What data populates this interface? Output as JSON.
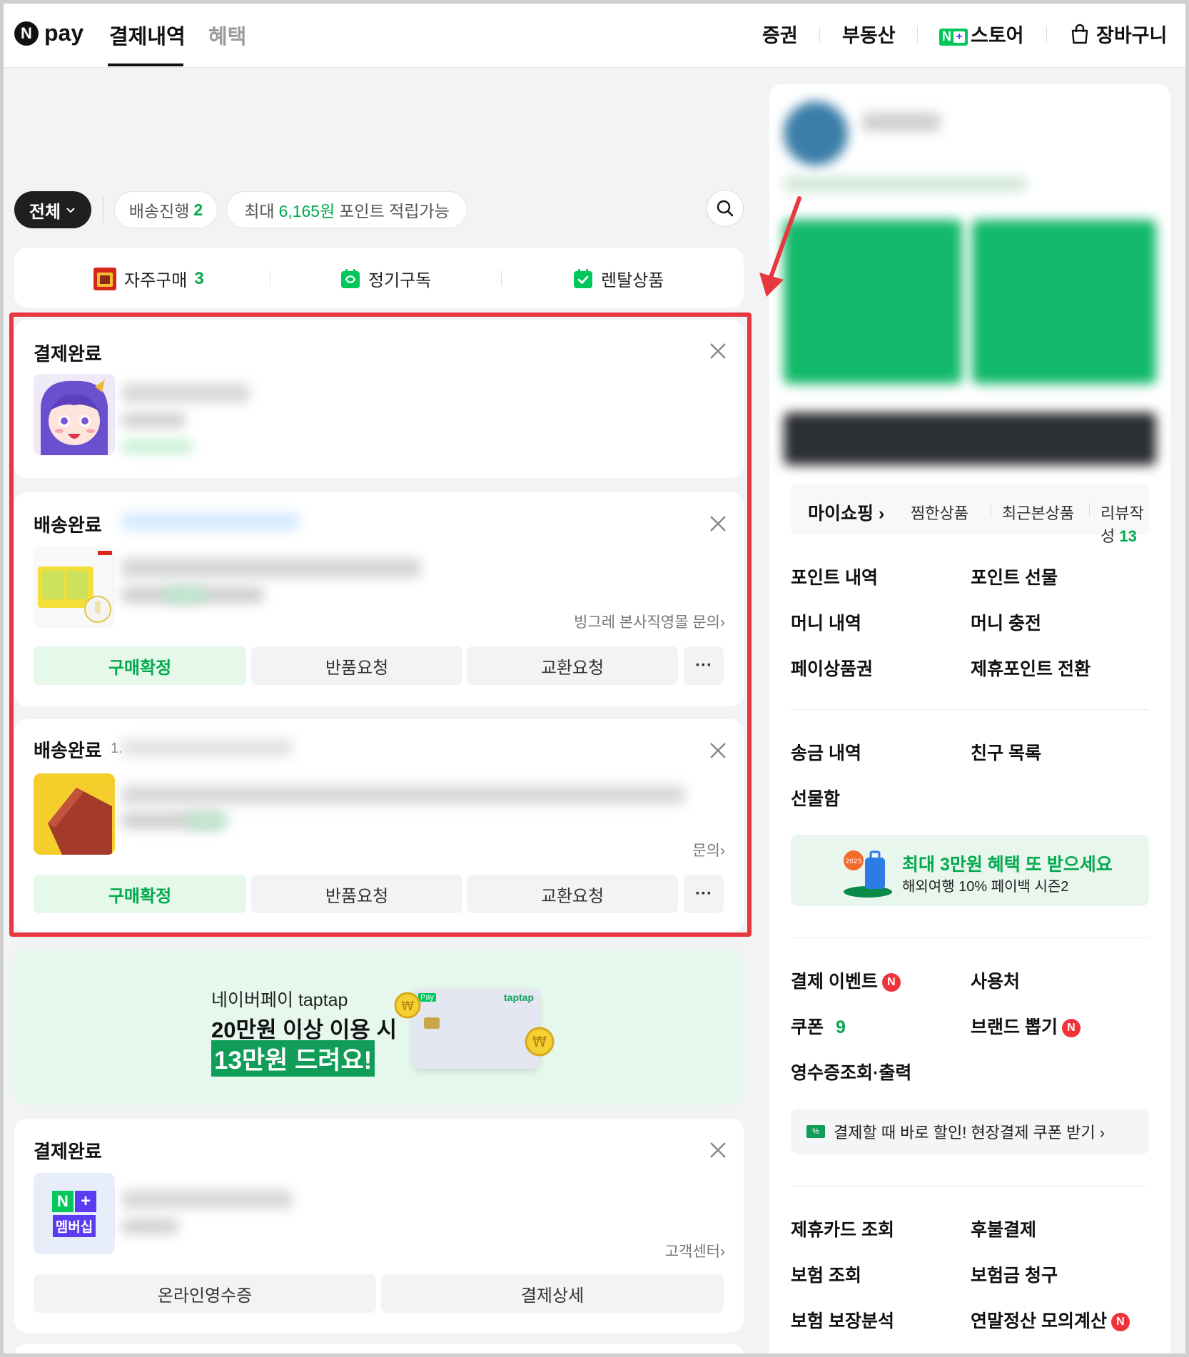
{
  "header": {
    "logo_n": "N",
    "logo_text": "pay",
    "tabs": [
      {
        "label": "결제내역",
        "active": true
      },
      {
        "label": "혜택",
        "active": false
      }
    ],
    "links": [
      "증권",
      "부동산",
      "스토어",
      "장바구니"
    ],
    "nplus_n": "N",
    "nplus_plus": "+"
  },
  "filters": {
    "all_label": "전체",
    "shipping_label": "배송진행",
    "shipping_count": "2",
    "points_prefix": "최대",
    "points_amount": "6,165원",
    "points_suffix": "포인트 적립가능"
  },
  "categories": [
    {
      "label": "자주구매",
      "count": "3"
    },
    {
      "label": "정기구독",
      "count": ""
    },
    {
      "label": "렌탈상품",
      "count": ""
    }
  ],
  "orders": [
    {
      "status": "결제완료"
    },
    {
      "status": "배송완료",
      "inquiry": "빙그레 본사직영몰 문의",
      "buttons": [
        "구매확정",
        "반품요청",
        "교환요청"
      ]
    },
    {
      "status": "배송완료",
      "date_prefix": "1.",
      "inquiry_tail": "문의",
      "buttons": [
        "구매확정",
        "반품요청",
        "교환요청"
      ]
    },
    {
      "status": "결제완료",
      "thumb_line1": "N",
      "thumb_plus": "+",
      "thumb_line2": "멤버십",
      "inquiry": "고객센터",
      "buttons": [
        "온라인영수증",
        "결제상세"
      ]
    }
  ],
  "more_label": "···",
  "banner": {
    "line1": "네이버페이 taptap",
    "line2": "20만원 이상 이용 시",
    "line3": "13만원 드려요!",
    "card_pay": "Pay",
    "card_brand": "taptap"
  },
  "right": {
    "myshopping": "마이쇼핑",
    "myshopping_links": [
      "찜한상품",
      "최근본상품",
      "리뷰작성"
    ],
    "review_count": "13",
    "group1": [
      "포인트 내역",
      "포인트 선물",
      "머니 내역",
      "머니 충전",
      "페이상품권",
      "제휴포인트 전환"
    ],
    "group2": [
      "송금 내역",
      "친구 목록",
      "선물함"
    ],
    "promo_title": "최대 3만원 혜택 또 받으세요",
    "promo_sub": "해외여행 10% 페이백 시즌2",
    "promo_badge": "2025",
    "group3": {
      "event": "결제 이벤트",
      "usage": "사용처",
      "coupon": "쿠폰",
      "coupon_count": "9",
      "brand": "브랜드 뽑기",
      "receipt": "영수증조회·출력"
    },
    "coupon_banner": "결제할 때 바로 할인! 현장결제 쿠폰 받기",
    "coupon_icon_text": "%",
    "group4": [
      "제휴카드 조회",
      "후불결제",
      "보험 조회",
      "보험금 청구",
      "보험 보장분석",
      "연말정산 모의계산"
    ],
    "badge_n": "N"
  }
}
